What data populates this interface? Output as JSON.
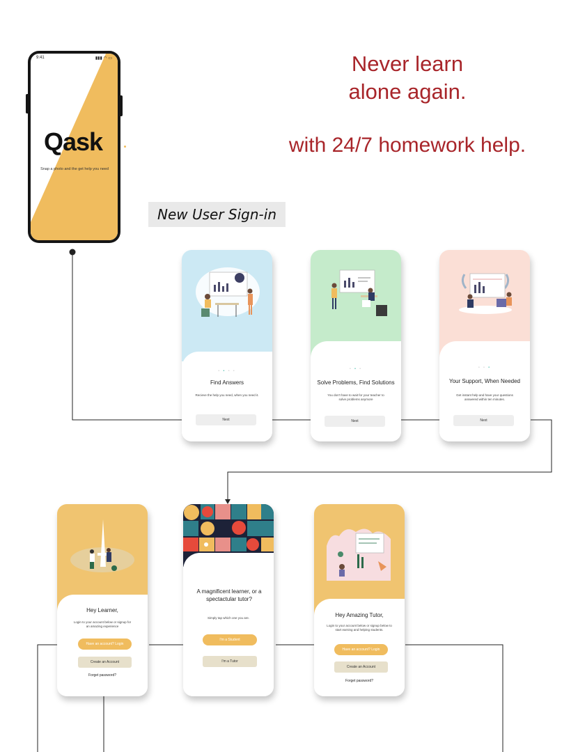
{
  "colors": {
    "brand_red": "#a8252a",
    "accent_orange": "#f0bc5e",
    "blue": "#cce9f4",
    "green": "#c5ebcb",
    "peach": "#fbdfd6",
    "tan": "#e7e0cb",
    "grey_button": "#eeeeee"
  },
  "splash": {
    "status_time": "9:41",
    "logo": "Qask",
    "tagline": "Snap a photo and the get help you need"
  },
  "hero": {
    "line1": "Never learn alone again.",
    "line2": "with 24/7 homework help."
  },
  "section_label": "New User Sign-in",
  "onboarding": [
    {
      "title": "Find Answers",
      "body": "Recieve the help you need, when you need it.",
      "button": "Next"
    },
    {
      "title": "Solve Problems, Find Solutions",
      "body": "You don't have to wait for your teacher to solve problems anymore",
      "button": "Next"
    },
    {
      "title": "Your Support, When Needed",
      "body": "Get instant help and have your questions answered within ten minutes.",
      "button": "Next"
    }
  ],
  "learner": {
    "title": "Hey Learner,",
    "body": "Login to your account below or signup for an amazing experience",
    "primary": "Have an account? Login",
    "secondary": "Create an Account",
    "forgot": "Forget password?"
  },
  "role": {
    "title": "A magnificent learner, or a spectactular tutor?",
    "body": "Simply tap which one you are.",
    "student": "I'm a Student",
    "tutor": "I'm a Tutor"
  },
  "tutor": {
    "title": "Hey Amazing Tutor,",
    "body": "Login to your account below or signup below to start earning and helping students.",
    "primary": "Have an account? Login",
    "secondary": "Create an Account",
    "forgot": "Forget password?"
  }
}
